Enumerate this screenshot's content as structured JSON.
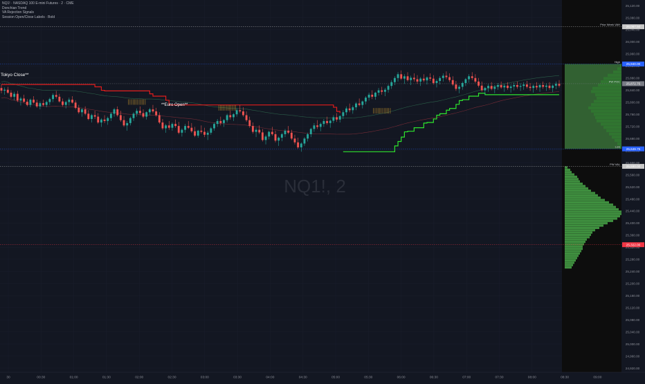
{
  "legend": {
    "title": "NQ1! · NASDAQ 100 E-mini Futures · 2 · CME",
    "indicators": [
      "Donchian Trend",
      "VA Rejection Signals",
      "Session Open/Close Labels · Bold"
    ]
  },
  "watermark": "NQ1!, 2",
  "colors": {
    "background": "#131722",
    "grid": "#1c2030",
    "candle_up": "#26a69a",
    "candle_down": "#ef5350",
    "donchian_down": "#e31c1c",
    "donchian_up": "#2ee62e",
    "signal": "#d8a02c",
    "profile_fill": "#3f8f3f",
    "value_area": "#52a852",
    "axis_text": "#8c8f98"
  },
  "session_labels": [
    "Tokyo Close**",
    "**Euro Open**"
  ],
  "chart_data": {
    "type": "candlestick",
    "symbol": "NQ1!",
    "timeframe": "2",
    "x_ticks": [
      "30",
      "00:30",
      "01:00",
      "01:30",
      "02:00",
      "02:30",
      "03:00",
      "03:30",
      "04:00",
      "04:30",
      "05:00",
      "05:30",
      "06:00",
      "06:30",
      "07:00",
      "07:30",
      "08:00",
      "08:30",
      "09:00"
    ],
    "y_ticks": [
      "25,120.00",
      "25,080.00",
      "25,040.00",
      "26,000.00",
      "25,960.00",
      "25,920.00",
      "25,880.00",
      "25,840.00",
      "25,800.00",
      "25,760.00",
      "25,720.00",
      "25,680.00",
      "25,640.00",
      "25,600.00",
      "25,560.00",
      "25,520.00",
      "25,480.00",
      "25,440.00",
      "25,400.00",
      "25,360.00",
      "25,320.00",
      "25,280.00",
      "25,240.00",
      "25,200.00",
      "25,160.00",
      "25,120.00",
      "25,080.00",
      "25,040.00",
      "25,000.00",
      "24,960.00",
      "24,920.00"
    ],
    "ylim": [
      24900,
      26140
    ],
    "price_lines": [
      {
        "label": "Prior Week VAH",
        "value": 26067.5,
        "price_text": "26,067.50",
        "color": "#c9c9c9"
      },
      {
        "label": "High",
        "value": 25940.0,
        "price_text": "25,940.00",
        "color": "#2962ff"
      },
      {
        "label": "PW POC",
        "value": 25872.75,
        "price_text": "25,872.75",
        "color": "#7a7d86"
      },
      {
        "label": "Low",
        "value": 25649.75,
        "price_text": "25,649.75",
        "color": "#2962ff"
      },
      {
        "label": "PW VAL",
        "value": 25590.0,
        "price_text": "25,590.00",
        "color": "#c9c9c9"
      },
      {
        "label": "",
        "value": 25322.0,
        "price_text": "25,322.00",
        "color": "#f23645"
      }
    ],
    "candles": [
      [
        25858,
        25870,
        25840,
        25849
      ],
      [
        25849,
        25860,
        25835,
        25852
      ],
      [
        25852,
        25862,
        25838,
        25842
      ],
      [
        25842,
        25850,
        25822,
        25828
      ],
      [
        25828,
        25845,
        25815,
        25838
      ],
      [
        25838,
        25848,
        25810,
        25815
      ],
      [
        25815,
        25828,
        25798,
        25822
      ],
      [
        25822,
        25835,
        25808,
        25811
      ],
      [
        25811,
        25820,
        25795,
        25800
      ],
      [
        25800,
        25822,
        25792,
        25818
      ],
      [
        25818,
        25830,
        25805,
        25808
      ],
      [
        25808,
        25818,
        25790,
        25795
      ],
      [
        25795,
        25812,
        25785,
        25806
      ],
      [
        25806,
        25818,
        25795,
        25800
      ],
      [
        25800,
        25815,
        25792,
        25810
      ],
      [
        25810,
        25825,
        25800,
        25820
      ],
      [
        25820,
        25840,
        25810,
        25834
      ],
      [
        25834,
        25848,
        25822,
        25828
      ],
      [
        25828,
        25838,
        25808,
        25812
      ],
      [
        25812,
        25822,
        25795,
        25800
      ],
      [
        25800,
        25815,
        25788,
        25810
      ],
      [
        25810,
        25825,
        25798,
        25818
      ],
      [
        25818,
        25830,
        25805,
        25808
      ],
      [
        25808,
        25816,
        25785,
        25790
      ],
      [
        25790,
        25800,
        25770,
        25775
      ],
      [
        25775,
        25790,
        25760,
        25785
      ],
      [
        25785,
        25795,
        25765,
        25770
      ],
      [
        25770,
        25782,
        25748,
        25752
      ],
      [
        25752,
        25770,
        25740,
        25765
      ],
      [
        25765,
        25780,
        25752,
        25760
      ],
      [
        25760,
        25772,
        25735,
        25740
      ],
      [
        25740,
        25755,
        25725,
        25750
      ],
      [
        25750,
        25765,
        25738,
        25745
      ],
      [
        25745,
        25760,
        25732,
        25755
      ],
      [
        25755,
        25775,
        25745,
        25770
      ],
      [
        25770,
        25790,
        25760,
        25785
      ],
      [
        25785,
        25795,
        25760,
        25765
      ],
      [
        25765,
        25780,
        25742,
        25748
      ],
      [
        25748,
        25762,
        25725,
        25730
      ],
      [
        25730,
        25745,
        25712,
        25738
      ],
      [
        25738,
        25760,
        25730,
        25755
      ],
      [
        25755,
        25775,
        25745,
        25770
      ],
      [
        25770,
        25788,
        25760,
        25780
      ],
      [
        25780,
        25795,
        25765,
        25772
      ],
      [
        25772,
        25785,
        25755,
        25760
      ],
      [
        25760,
        25778,
        25750,
        25775
      ],
      [
        25775,
        25790,
        25765,
        25785
      ],
      [
        25785,
        25800,
        25772,
        25778
      ],
      [
        25778,
        25790,
        25760,
        25765
      ],
      [
        25765,
        25775,
        25735,
        25740
      ],
      [
        25740,
        25752,
        25715,
        25720
      ],
      [
        25720,
        25735,
        25705,
        25730
      ],
      [
        25730,
        25745,
        25715,
        25722
      ],
      [
        25722,
        25740,
        25712,
        25735
      ],
      [
        25735,
        25750,
        25722,
        25728
      ],
      [
        25728,
        25742,
        25700,
        25705
      ],
      [
        25705,
        25720,
        25692,
        25715
      ],
      [
        25715,
        25735,
        25705,
        25728
      ],
      [
        25728,
        25745,
        25718,
        25722
      ],
      [
        25722,
        25738,
        25705,
        25710
      ],
      [
        25710,
        25725,
        25690,
        25695
      ],
      [
        25695,
        25715,
        25688,
        25712
      ],
      [
        25712,
        25730,
        25702,
        25708
      ],
      [
        25708,
        25722,
        25690,
        25698
      ],
      [
        25698,
        25712,
        25680,
        25705
      ],
      [
        25705,
        25725,
        25698,
        25720
      ],
      [
        25720,
        25740,
        25712,
        25735
      ],
      [
        25735,
        25752,
        25725,
        25745
      ],
      [
        25745,
        25760,
        25730,
        25738
      ],
      [
        25738,
        25752,
        25725,
        25748
      ],
      [
        25748,
        25770,
        25740,
        25765
      ],
      [
        25765,
        25780,
        25750,
        25758
      ],
      [
        25758,
        25772,
        25745,
        25768
      ],
      [
        25768,
        25788,
        25760,
        25782
      ],
      [
        25782,
        25800,
        25772,
        25778
      ],
      [
        25778,
        25792,
        25760,
        25765
      ],
      [
        25765,
        25778,
        25742,
        25748
      ],
      [
        25748,
        25760,
        25722,
        25728
      ],
      [
        25728,
        25740,
        25702,
        25708
      ],
      [
        25708,
        25722,
        25690,
        25715
      ],
      [
        25715,
        25730,
        25700,
        25706
      ],
      [
        25706,
        25718,
        25675,
        25680
      ],
      [
        25680,
        25698,
        25665,
        25692
      ],
      [
        25692,
        25712,
        25682,
        25708
      ],
      [
        25708,
        25725,
        25695,
        25700
      ],
      [
        25700,
        25712,
        25672,
        25678
      ],
      [
        25678,
        25692,
        25660,
        25688
      ],
      [
        25688,
        25705,
        25676,
        25700
      ],
      [
        25700,
        25718,
        25690,
        25712
      ],
      [
        25712,
        25728,
        25700,
        25705
      ],
      [
        25705,
        25715,
        25680,
        25685
      ],
      [
        25685,
        25698,
        25665,
        25672
      ],
      [
        25672,
        25688,
        25650,
        25655
      ],
      [
        25655,
        25672,
        25640,
        25668
      ],
      [
        25668,
        25690,
        25660,
        25685
      ],
      [
        25685,
        25705,
        25675,
        25700
      ],
      [
        25700,
        25722,
        25690,
        25718
      ],
      [
        25718,
        25738,
        25708,
        25730
      ],
      [
        25730,
        25748,
        25718,
        25725
      ],
      [
        25725,
        25740,
        25710,
        25735
      ],
      [
        25735,
        25752,
        25725,
        25745
      ],
      [
        25745,
        25760,
        25732,
        25738
      ],
      [
        25738,
        25750,
        25722,
        25746
      ],
      [
        25746,
        25765,
        25738,
        25758
      ],
      [
        25758,
        25772,
        25742,
        25750
      ],
      [
        25750,
        25765,
        25740,
        25762
      ],
      [
        25762,
        25782,
        25752,
        25775
      ],
      [
        25775,
        25795,
        25765,
        25788
      ],
      [
        25788,
        25805,
        25775,
        25782
      ],
      [
        25782,
        25798,
        25770,
        25792
      ],
      [
        25792,
        25810,
        25782,
        25805
      ],
      [
        25805,
        25822,
        25795,
        25800
      ],
      [
        25800,
        25815,
        25788,
        25812
      ],
      [
        25812,
        25830,
        25802,
        25825
      ],
      [
        25825,
        25842,
        25815,
        25835
      ],
      [
        25835,
        25850,
        25820,
        25828
      ],
      [
        25828,
        25845,
        25818,
        25842
      ],
      [
        25842,
        25858,
        25832,
        25850
      ],
      [
        25850,
        25862,
        25835,
        25845
      ],
      [
        25845,
        25858,
        25830,
        25852
      ],
      [
        25852,
        25870,
        25842,
        25865
      ],
      [
        25865,
        25885,
        25855,
        25878
      ],
      [
        25878,
        25898,
        25868,
        25892
      ],
      [
        25892,
        25912,
        25880,
        25905
      ],
      [
        25905,
        25918,
        25885,
        25890
      ],
      [
        25890,
        25905,
        25872,
        25898
      ],
      [
        25898,
        25912,
        25880,
        25885
      ],
      [
        25885,
        25900,
        25868,
        25893
      ],
      [
        25893,
        25908,
        25880,
        25888
      ],
      [
        25888,
        25902,
        25872,
        25880
      ],
      [
        25880,
        25895,
        25865,
        25890
      ],
      [
        25890,
        25905,
        25878,
        25884
      ],
      [
        25884,
        25898,
        25870,
        25894
      ],
      [
        25894,
        25908,
        25882,
        25890
      ],
      [
        25890,
        25902,
        25870,
        25875
      ],
      [
        25875,
        25888,
        25860,
        25882
      ],
      [
        25882,
        25898,
        25870,
        25892
      ],
      [
        25892,
        25908,
        25880,
        25900
      ],
      [
        25900,
        25915,
        25888,
        25895
      ],
      [
        25895,
        25908,
        25878,
        25885
      ],
      [
        25885,
        25898,
        25865,
        25870
      ],
      [
        25870,
        25882,
        25848,
        25855
      ],
      [
        25855,
        25868,
        25840,
        25862
      ],
      [
        25862,
        25880,
        25852,
        25875
      ],
      [
        25875,
        25892,
        25865,
        25888
      ],
      [
        25888,
        25905,
        25876,
        25898
      ],
      [
        25898,
        25912,
        25885,
        25892
      ],
      [
        25892,
        25905,
        25875,
        25880
      ],
      [
        25880,
        25892,
        25860,
        25866
      ],
      [
        25866,
        25880,
        25845,
        25850
      ],
      [
        25850,
        25862,
        25835,
        25858
      ],
      [
        25858,
        25872,
        25845,
        25865
      ],
      [
        25865,
        25878,
        25850,
        25855
      ],
      [
        25855,
        25868,
        25840,
        25862
      ],
      [
        25862,
        25875,
        25852,
        25868
      ],
      [
        25868,
        25880,
        25855,
        25860
      ],
      [
        25860,
        25872,
        25845,
        25866
      ],
      [
        25866,
        25878,
        25852,
        25858
      ],
      [
        25858,
        25870,
        25842,
        25863
      ],
      [
        25863,
        25876,
        25850,
        25868
      ],
      [
        25868,
        25880,
        25855,
        25862
      ],
      [
        25862,
        25874,
        25848,
        25865
      ],
      [
        25865,
        25878,
        25852,
        25870
      ],
      [
        25870,
        25882,
        25856,
        25862
      ],
      [
        25862,
        25875,
        25848,
        25858
      ],
      [
        25858,
        25870,
        25842,
        25865
      ],
      [
        25865,
        25878,
        25852,
        25860
      ],
      [
        25860,
        25872,
        25845,
        25868
      ],
      [
        25868,
        25880,
        25855,
        25862
      ],
      [
        25862,
        25874,
        25848,
        25866
      ],
      [
        25866,
        25878,
        25852,
        25858
      ],
      [
        25858,
        25870,
        25844,
        25866
      ],
      [
        25866,
        25880,
        25854,
        25872
      ],
      [
        25872,
        25885,
        25860,
        25866
      ]
    ],
    "volume_profile_upper": [
      2,
      6,
      12,
      20,
      26,
      30,
      34,
      42,
      44,
      38,
      36,
      40,
      44,
      48,
      44,
      40,
      38,
      36,
      30,
      26,
      22,
      18,
      14,
      10,
      6,
      3
    ],
    "volume_profile_lower": [
      4,
      8,
      10,
      14,
      18,
      20,
      22,
      26,
      30,
      34,
      38,
      44,
      48,
      52,
      58,
      64,
      70,
      74,
      78,
      82,
      86,
      80,
      76,
      70,
      62,
      56,
      50,
      44,
      40,
      38,
      36,
      32,
      30,
      28,
      26,
      26,
      24,
      22,
      20,
      18,
      16,
      14,
      12,
      10
    ]
  }
}
